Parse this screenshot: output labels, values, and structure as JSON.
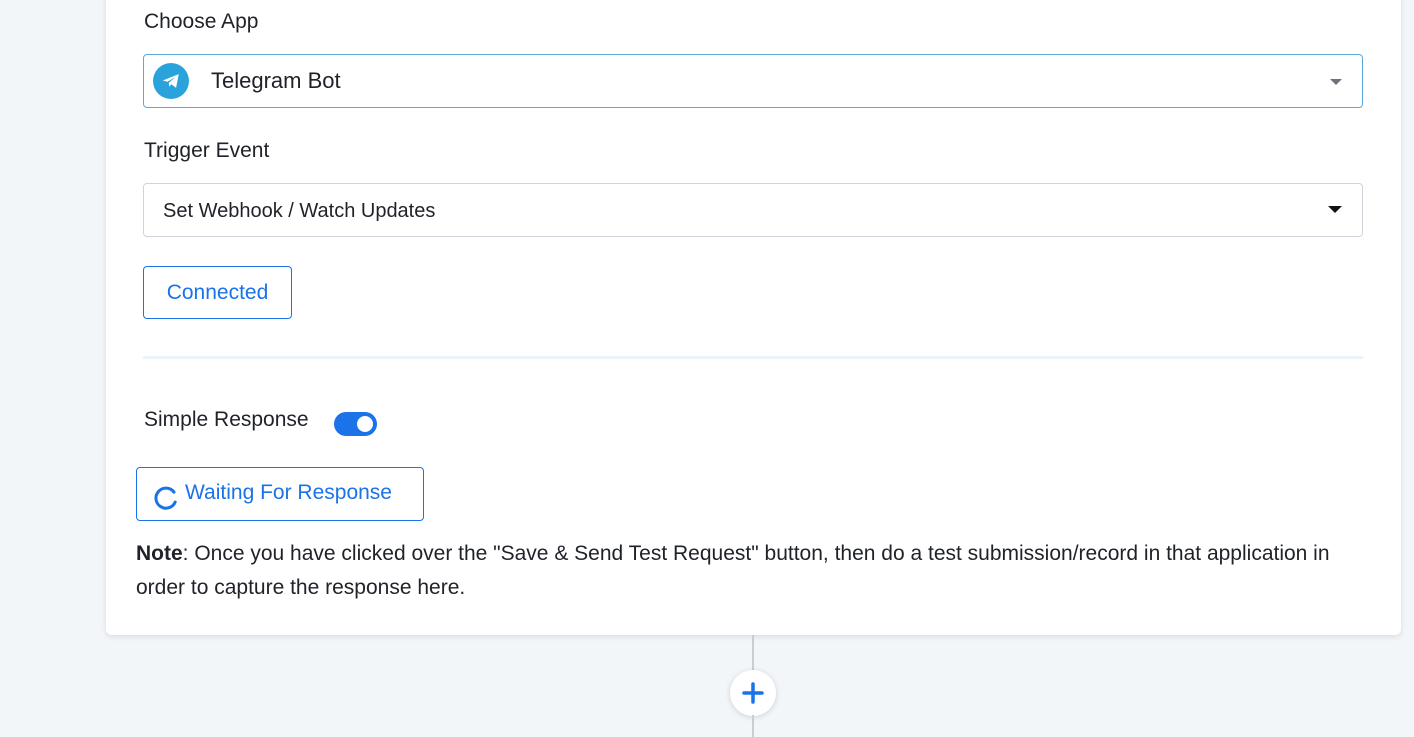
{
  "choose_app": {
    "label": "Choose App",
    "selected_app": "Telegram Bot",
    "app_icon": "telegram-icon"
  },
  "trigger_event": {
    "label": "Trigger Event",
    "selected": "Set Webhook / Watch Updates"
  },
  "connection": {
    "button_label": "Connected"
  },
  "simple_response": {
    "label": "Simple Response",
    "enabled": true
  },
  "waiting": {
    "button_label": "Waiting For Response"
  },
  "note": {
    "prefix": "Note",
    "text": ": Once you have clicked over the \"Save & Send Test Request\" button, then do a test submission/record in that application in order to capture the response here."
  },
  "colors": {
    "accent": "#1a73e8",
    "telegram": "#2aa3dc",
    "background": "#f3f6f9"
  }
}
